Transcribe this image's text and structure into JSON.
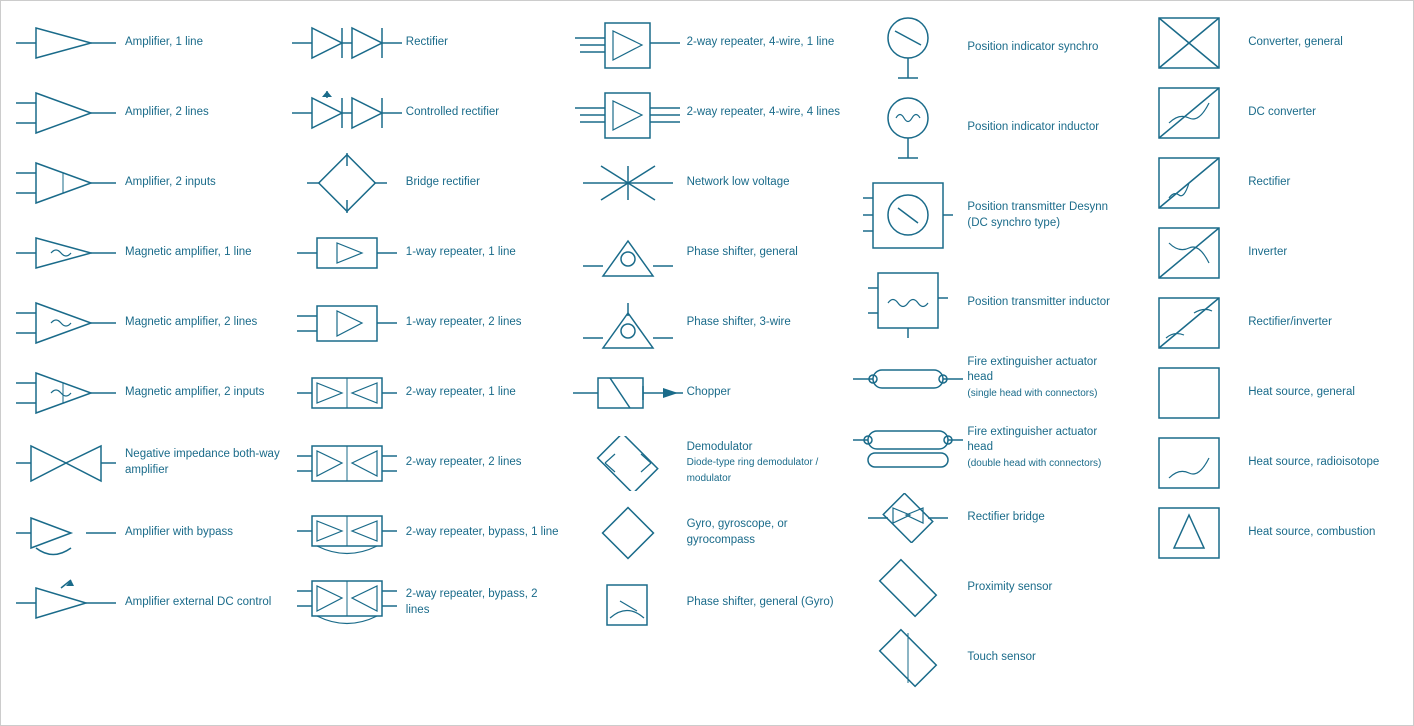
{
  "items": [
    {
      "id": "amp1",
      "label": "Amplifier, 1 line",
      "col": 0
    },
    {
      "id": "amp2",
      "label": "Amplifier, 2 lines",
      "col": 0
    },
    {
      "id": "amp2i",
      "label": "Amplifier, 2 inputs",
      "col": 0
    },
    {
      "id": "magamp1",
      "label": "Magnetic amplifier, 1 line",
      "col": 0
    },
    {
      "id": "magamp2",
      "label": "Magnetic amplifier, 2 lines",
      "col": 0
    },
    {
      "id": "magamp2i",
      "label": "Magnetic amplifier, 2 inputs",
      "col": 0
    },
    {
      "id": "negamp",
      "label": "Negative impedance both-way amplifier",
      "col": 0
    },
    {
      "id": "ampbypass",
      "label": "Amplifier with bypass",
      "col": 0
    },
    {
      "id": "ampdc",
      "label": "Amplifier external DC control",
      "col": 0
    },
    {
      "id": "rect",
      "label": "Rectifier",
      "col": 1
    },
    {
      "id": "crect",
      "label": "Controlled rectifier",
      "col": 1
    },
    {
      "id": "bridge",
      "label": "Bridge rectifier",
      "col": 1
    },
    {
      "id": "rep1w1",
      "label": "1-way repeater, 1 line",
      "col": 1
    },
    {
      "id": "rep1w2",
      "label": "1-way repeater, 2 lines",
      "col": 1
    },
    {
      "id": "rep2w1",
      "label": "2-way repeater, 1 line",
      "col": 1
    },
    {
      "id": "rep2w2",
      "label": "2-way repeater, 2 lines",
      "col": 1
    },
    {
      "id": "rep2wb1",
      "label": "2-way repeater, bypass, 1 line",
      "col": 1
    },
    {
      "id": "rep2wb2",
      "label": "2-way repeater, bypass, 2 lines",
      "col": 1
    },
    {
      "id": "rep4w1l",
      "label": "2-way repeater, 4-wire, 1 line",
      "col": 2
    },
    {
      "id": "rep4w4l",
      "label": "2-way repeater, 4-wire, 4 lines",
      "col": 2
    },
    {
      "id": "netlv",
      "label": "Network low voltage",
      "col": 2
    },
    {
      "id": "phaseg",
      "label": "Phase shifter, general",
      "col": 2
    },
    {
      "id": "phase3",
      "label": "Phase shifter, 3-wire",
      "col": 2
    },
    {
      "id": "chopper",
      "label": "Chopper",
      "col": 2
    },
    {
      "id": "demod",
      "label": "Demodulator",
      "sublabel": "Diode-type ring demodulator / modulator",
      "col": 2
    },
    {
      "id": "gyro",
      "label": "Gyro, gyroscope, or gyrocompass",
      "col": 2
    },
    {
      "id": "phasegyro",
      "label": "Phase shifter, general (Gyro)",
      "col": 2
    },
    {
      "id": "possynchro",
      "label": "Position indicator synchro",
      "col": 3
    },
    {
      "id": "posinductor",
      "label": "Position indicator inductor",
      "col": 3
    },
    {
      "id": "postransdesynn",
      "label": "Position transmitter Desynn (DC synchro type)",
      "col": 3
    },
    {
      "id": "postransinductor",
      "label": "Position transmitter inductor",
      "col": 3
    },
    {
      "id": "firehead1",
      "label": "Fire extinguisher actuator head",
      "sublabel": "(single head with connectors)",
      "col": 3
    },
    {
      "id": "firehead2",
      "label": "Fire extinguisher actuator head",
      "sublabel": "(double head with connectors)",
      "col": 3
    },
    {
      "id": "rectbridge",
      "label": "Rectifier bridge",
      "col": 3
    },
    {
      "id": "proximity",
      "label": "Proximity sensor",
      "col": 3
    },
    {
      "id": "touch",
      "label": "Touch sensor",
      "col": 3
    },
    {
      "id": "convgen",
      "label": "Converter, general",
      "col": 4
    },
    {
      "id": "dcconv",
      "label": "DC converter",
      "col": 4
    },
    {
      "id": "rect4",
      "label": "Rectifier",
      "col": 4
    },
    {
      "id": "inverter",
      "label": "Inverter",
      "col": 4
    },
    {
      "id": "rectinv",
      "label": "Rectifier/inverter",
      "col": 4
    },
    {
      "id": "heatsrc",
      "label": "Heat source, general",
      "col": 4
    },
    {
      "id": "heatrad",
      "label": "Heat source, radioisotope",
      "col": 4
    },
    {
      "id": "heatcomb",
      "label": "Heat source, combustion",
      "col": 4
    }
  ]
}
